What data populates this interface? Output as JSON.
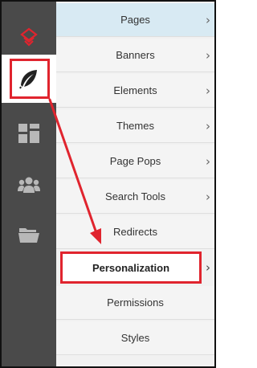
{
  "rail": {
    "items": [
      {
        "icon": "logo-icon"
      },
      {
        "icon": "feather-icon",
        "active": true
      },
      {
        "icon": "dashboard-icon"
      },
      {
        "icon": "users-icon"
      },
      {
        "icon": "folder-icon"
      }
    ]
  },
  "menu": {
    "items": [
      {
        "label": "Pages",
        "chevron": "›"
      },
      {
        "label": "Banners",
        "chevron": "›"
      },
      {
        "label": "Elements",
        "chevron": "›"
      },
      {
        "label": "Themes",
        "chevron": "›"
      },
      {
        "label": "Page Pops",
        "chevron": "›"
      },
      {
        "label": "Search Tools",
        "chevron": "›"
      },
      {
        "label": "Redirects",
        "chevron": ""
      },
      {
        "label": "Personalization",
        "chevron": "›"
      },
      {
        "label": "Permissions",
        "chevron": ""
      },
      {
        "label": "Styles",
        "chevron": ""
      }
    ]
  },
  "colors": {
    "rail_bg": "#4a4a4a",
    "accent_red": "#e0242e",
    "selected_bg": "#d8eaf3"
  }
}
